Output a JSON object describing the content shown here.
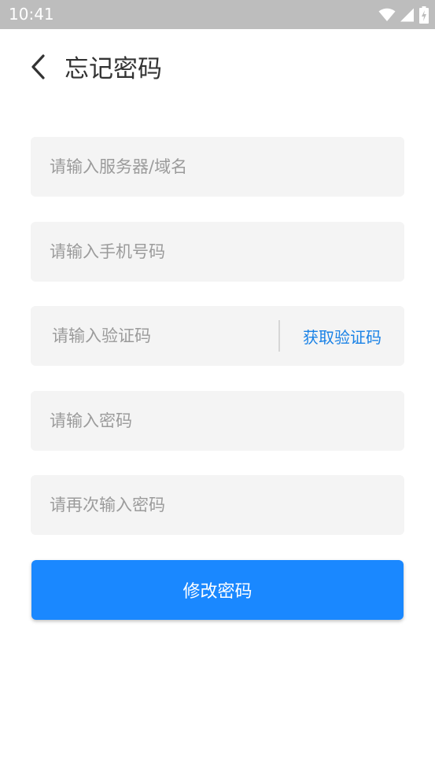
{
  "status_bar": {
    "time": "10:41",
    "icons": [
      "wifi-icon",
      "signal-icon",
      "battery-charging-icon"
    ]
  },
  "header": {
    "back_icon": "chevron-left-icon",
    "title": "忘记密码"
  },
  "form": {
    "server_placeholder": "请输入服务器/域名",
    "phone_placeholder": "请输入手机号码",
    "code_placeholder": "请输入验证码",
    "get_code_label": "获取验证码",
    "password_placeholder": "请输入密码",
    "confirm_password_placeholder": "请再次输入密码",
    "submit_label": "修改密码"
  },
  "colors": {
    "status_bar": "#bdbdbd",
    "field_bg": "#f4f4f4",
    "accent": "#1a88ff",
    "link": "#1a82e6"
  }
}
